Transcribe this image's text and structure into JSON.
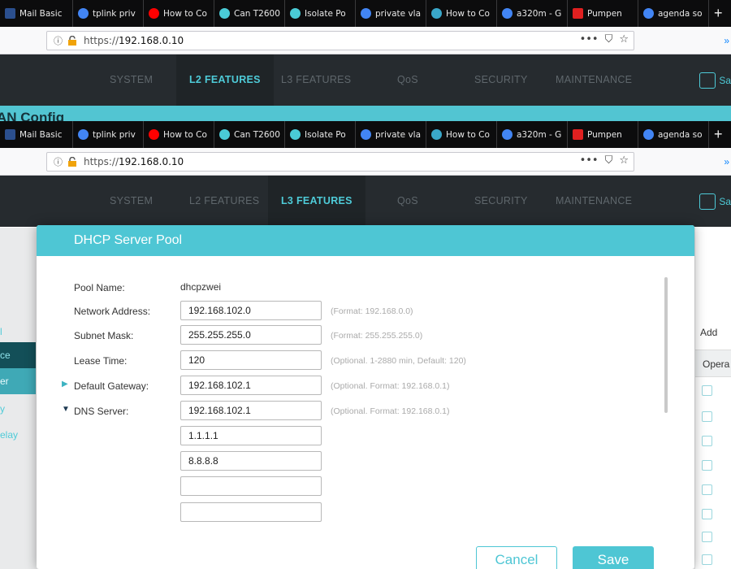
{
  "browser": {
    "tabs": [
      {
        "label": "Mail Basic",
        "icon": "mail-icon",
        "color": "#2b4f8e"
      },
      {
        "label": "tplink priv",
        "icon": "google-icon",
        "color": "#4285f4"
      },
      {
        "label": "How to Co",
        "icon": "youtube-icon",
        "color": "#ff0000"
      },
      {
        "label": "Can T2600",
        "icon": "tplink-icon",
        "color": "#4acbd6"
      },
      {
        "label": "Isolate Po",
        "icon": "tplink-icon",
        "color": "#4acbd6"
      },
      {
        "label": "private vla",
        "icon": "google-icon",
        "color": "#4285f4"
      },
      {
        "label": "How to Co",
        "icon": "site-icon",
        "color": "#3aa7c9"
      },
      {
        "label": "a320m - G",
        "icon": "google-icon",
        "color": "#4285f4"
      },
      {
        "label": "Pumpen",
        "icon": "adobe-icon",
        "color": "#e02020"
      },
      {
        "label": "agenda so",
        "icon": "google-icon",
        "color": "#4285f4"
      }
    ],
    "new_tab": "+",
    "url_prefix": "https://",
    "url_host": "192.168.0.10",
    "url_actions": {
      "more": "•••",
      "pocket": "⛉",
      "bookmark": "☆"
    },
    "info_glyph": "ⓘ",
    "overflow": "»"
  },
  "nav_back": {
    "items": [
      "SYSTEM",
      "L2 FEATURES",
      "L3 FEATURES",
      "QoS",
      "SECURITY",
      "MAINTENANCE"
    ],
    "active": "L2 FEATURES",
    "save_label": "Sa"
  },
  "nav_front": {
    "items": [
      "SYSTEM",
      "L2 FEATURES",
      "L3 FEATURES",
      "QoS",
      "SECURITY",
      "MAINTENANCE"
    ],
    "active": "L3 FEATURES",
    "save_label": "Sa"
  },
  "cyan_strip_text": "AN Config",
  "side_menu": [
    "l",
    "ce",
    "er",
    "y",
    "elay"
  ],
  "right_pane": {
    "add_label": "Add",
    "header": "Opera"
  },
  "modal": {
    "title": "DHCP Server Pool",
    "pool_name_label": "Pool Name:",
    "pool_name_value": "dhcpzwei",
    "fields": {
      "network_address": {
        "label": "Network Address:",
        "value": "192.168.102.0",
        "hint": "(Format: 192.168.0.0)"
      },
      "subnet_mask": {
        "label": "Subnet Mask:",
        "value": "255.255.255.0",
        "hint": "(Format: 255.255.255.0)"
      },
      "lease_time": {
        "label": "Lease Time:",
        "value": "120",
        "hint": "(Optional. 1-2880 min, Default: 120)"
      },
      "default_gateway": {
        "label": "Default Gateway:",
        "value": "192.168.102.1",
        "hint": "(Optional. Format: 192.168.0.1)"
      },
      "dns_server": {
        "label": "DNS Server:",
        "value": "192.168.102.1",
        "hint": "(Optional. Format: 192.168.0.1)"
      }
    },
    "dns_extra": [
      "1.1.1.1",
      "8.8.8.8",
      "",
      ""
    ],
    "cancel_label": "Cancel",
    "save_label": "Save"
  },
  "colors": {
    "accent": "#4ec6d4",
    "nav_bg": "#262b2f"
  }
}
